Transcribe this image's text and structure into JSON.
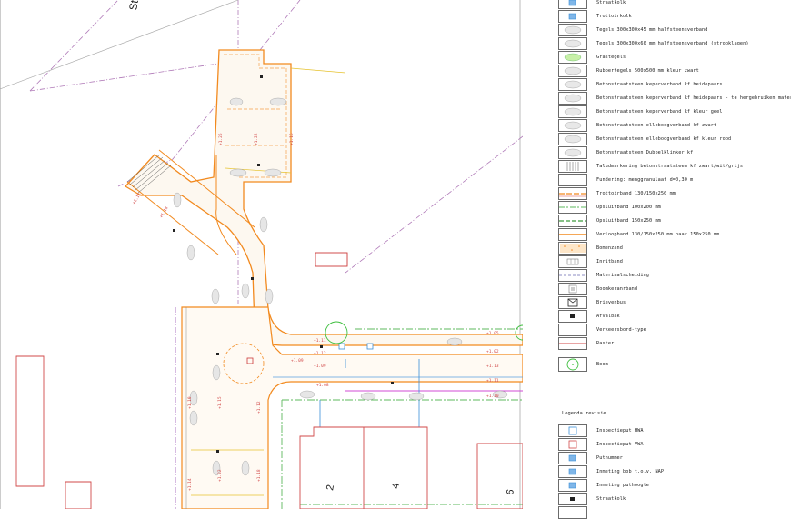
{
  "drawing": {
    "street_label": "St",
    "house_numbers": [
      "2",
      "4",
      "6"
    ],
    "dims_vertical": [
      "+1.25",
      "+1.22",
      "+1.16",
      "+1.12",
      "+1.18",
      "+1.15",
      "+1.10"
    ],
    "dims_street": [
      "+1.11",
      "+1.12",
      "+1.09",
      "+1.05",
      "+1.02",
      "+1.13",
      "+1.11",
      "+1.10",
      "+1.08"
    ],
    "dims_lower": [
      "+1.22",
      "+1.18",
      "+1.14",
      "+1.12",
      "+1.09"
    ]
  },
  "legend": {
    "items": [
      {
        "label": "Straatkolk",
        "symbol": "square-blue-dot"
      },
      {
        "label": "Trottoirkolk",
        "symbol": "square-blue-dot"
      },
      {
        "label": "Tegels 300x300x45 mm halfsteensverband",
        "symbol": "hatch-dots"
      },
      {
        "label": "Tegels 300x300x60 mm halfsteensverband (strooklagen)",
        "symbol": "hatch-dots"
      },
      {
        "label": "Grastegels",
        "symbol": "hatch-green"
      },
      {
        "label": "Rubbertegels 500x500 mm kleur zwart",
        "symbol": "hatch-dots"
      },
      {
        "label": "Betonstraatsteen keperverband kf heidepaars",
        "symbol": "hatch-dots"
      },
      {
        "label": "Betonstraatsteen keperverband kf heidepaars - te hergebruiken materialen",
        "symbol": "hatch-dots"
      },
      {
        "label": "Betonstraatsteen keperverband kf kleur geel",
        "symbol": "hatch-dots"
      },
      {
        "label": "Betonstraatsteen elleboogverband kf zwart",
        "symbol": "hatch-dots"
      },
      {
        "label": "Betonstraatsteen elleboogverband kf kleur rood",
        "symbol": "hatch-dots"
      },
      {
        "label": "Betonstraatsteen Dubbelklinker kf",
        "symbol": "hatch-dots"
      },
      {
        "label": "Taludmarkering betonstraatsteen kf zwart/wit/grijs",
        "symbol": "hatch-stripes"
      },
      {
        "label": "Fundering: menggranulaat d=0,30 m",
        "symbol": "empty"
      },
      {
        "label": "Trottoirband 130/150x250 mm",
        "symbol": "line-orange-red"
      },
      {
        "label": "Opsluitband 100x200 mm",
        "symbol": "line-green-dash"
      },
      {
        "label": "Opsluitband 150x250 mm",
        "symbol": "line-green-dash2"
      },
      {
        "label": "Verloopband 130/150x250 mm naar 150x250 mm",
        "symbol": "line-orange"
      },
      {
        "label": "Bomenzand",
        "symbol": "dots-orange"
      },
      {
        "label": "Inritband",
        "symbol": "inrit"
      },
      {
        "label": "Materiaalscheiding",
        "symbol": "line-dash-blue"
      },
      {
        "label": "Boomkeranrband",
        "symbol": "square-small"
      },
      {
        "label": "Brievenbus",
        "symbol": "envelope"
      },
      {
        "label": "Afvalbak",
        "symbol": "square-black"
      },
      {
        "label": "Verkeersbord-type",
        "symbol": "empty"
      },
      {
        "label": "Raster",
        "symbol": "line-red"
      },
      {
        "label": "Boom",
        "symbol": "circle-green"
      }
    ],
    "revision_title": "Legenda revisie",
    "revision_items": [
      {
        "label": "Inspectieput HWA",
        "symbol": "square-blue"
      },
      {
        "label": "Inspectieput VWA",
        "symbol": "square-red"
      },
      {
        "label": "Putnummer",
        "symbol": "square-blue-dot"
      },
      {
        "label": "Inmeting bob t.o.v. NAP",
        "symbol": "square-blue-dot"
      },
      {
        "label": "Inmeting puthoogte",
        "symbol": "square-blue-dot"
      },
      {
        "label": "Straatkolk",
        "symbol": "square-black"
      },
      {
        "label": "",
        "symbol": "empty"
      }
    ]
  }
}
